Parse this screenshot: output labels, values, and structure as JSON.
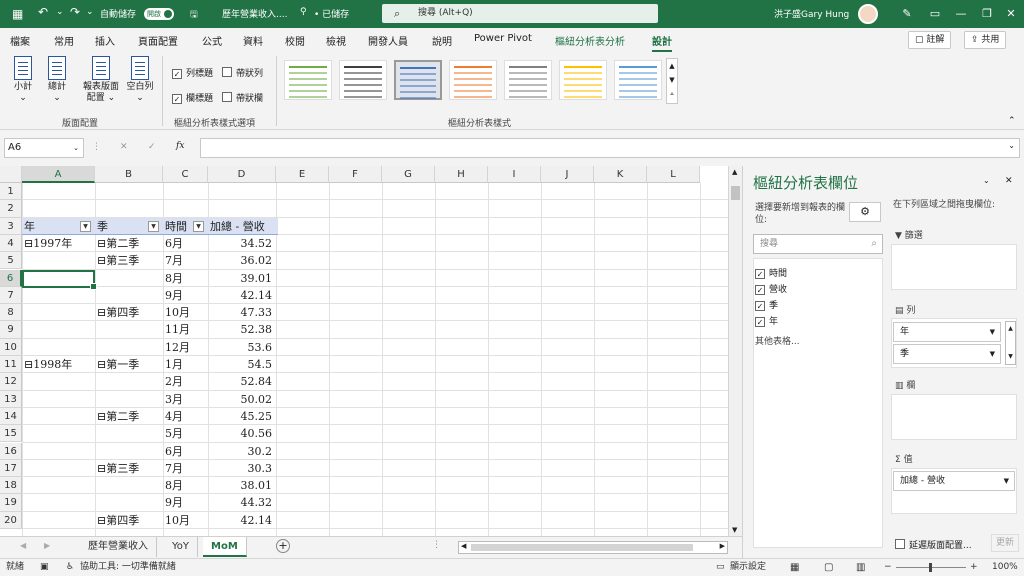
{
  "titlebar": {
    "autosave_label": "自動儲存",
    "autosave_state": "開啟",
    "filename": "歷年營業收入....",
    "save_status": "• 已儲存",
    "search_placeholder": "搜尋 (Alt+Q)",
    "user": "洪子盛Gary Hung"
  },
  "ribbon_tabs": [
    "檔案",
    "常用",
    "插入",
    "頁面配置",
    "公式",
    "資料",
    "校閱",
    "檢視",
    "開發人員",
    "說明",
    "Power Pivot",
    "樞紐分析表分析",
    "設計"
  ],
  "top_buttons": {
    "comment": "註解",
    "share": "共用"
  },
  "ribbon": {
    "layout_buttons": [
      {
        "label": "小計",
        "sub": "⌄"
      },
      {
        "label": "總計",
        "sub": "⌄"
      },
      {
        "label": "報表版面",
        "sub": "配置 ⌄"
      },
      {
        "label": "空白列",
        "sub": "⌄"
      }
    ],
    "layout_group": "版面配置",
    "options": [
      {
        "label": "列標題",
        "checked": true
      },
      {
        "label": "帶狀列",
        "checked": false
      },
      {
        "label": "欄標題",
        "checked": true
      },
      {
        "label": "帶狀欄",
        "checked": false
      }
    ],
    "options_group": "樞紐分析表樣式選項",
    "styles_group": "樞紐分析表樣式",
    "style_colors": [
      "#70ad47",
      "#404040",
      "#4472c4",
      "#ed7d31",
      "#808080",
      "#ffc000",
      "#5b9bd5"
    ]
  },
  "formula_bar": {
    "name_box": "A6",
    "fx": "fx",
    "cancel": "✕",
    "confirm": "✓"
  },
  "columns": [
    "A",
    "B",
    "C",
    "D",
    "E",
    "F",
    "G",
    "H",
    "I",
    "J",
    "K",
    "L"
  ],
  "rows": [
    "1",
    "2",
    "3",
    "4",
    "5",
    "6",
    "7",
    "8",
    "9",
    "10",
    "11",
    "12",
    "13",
    "14",
    "15",
    "16",
    "17",
    "18",
    "19",
    "20"
  ],
  "pivot": {
    "headers": [
      "年",
      "季",
      "時間",
      "加總 - 營收"
    ],
    "rows": [
      [
        "⊟1997年",
        "⊟第二季",
        "6月",
        "34.52"
      ],
      [
        "",
        "⊟第三季",
        "7月",
        "36.02"
      ],
      [
        "",
        "",
        "8月",
        "39.01"
      ],
      [
        "",
        "",
        "9月",
        "42.14"
      ],
      [
        "",
        "⊟第四季",
        "10月",
        "47.33"
      ],
      [
        "",
        "",
        "11月",
        "52.38"
      ],
      [
        "",
        "",
        "12月",
        "53.6"
      ],
      [
        "⊟1998年",
        "⊟第一季",
        "1月",
        "54.5"
      ],
      [
        "",
        "",
        "2月",
        "52.84"
      ],
      [
        "",
        "",
        "3月",
        "50.02"
      ],
      [
        "",
        "⊟第二季",
        "4月",
        "45.25"
      ],
      [
        "",
        "",
        "5月",
        "40.56"
      ],
      [
        "",
        "",
        "6月",
        "30.2"
      ],
      [
        "",
        "⊟第三季",
        "7月",
        "30.3"
      ],
      [
        "",
        "",
        "8月",
        "38.01"
      ],
      [
        "",
        "",
        "9月",
        "44.32"
      ],
      [
        "",
        "⊟第四季",
        "10月",
        "42.14"
      ]
    ]
  },
  "sheets": [
    "歷年營業收入",
    "YoY",
    "MoM"
  ],
  "active_sheet": "MoM",
  "pane": {
    "title": "樞紐分析表欄位",
    "choose_label": "選擇要新增到報表的欄位:",
    "drag_label": "在下列區域之間拖曳欄位:",
    "search_placeholder": "搜尋",
    "fields": [
      {
        "label": "時間",
        "checked": true
      },
      {
        "label": "營收",
        "checked": true
      },
      {
        "label": "季",
        "checked": true
      },
      {
        "label": "年",
        "checked": true
      }
    ],
    "more_tables": "其他表格...",
    "filters_label": "篩選",
    "rows_label": "列",
    "rows_fields": [
      "年",
      "季"
    ],
    "columns_label": "欄",
    "values_label": "值",
    "values_fields": [
      "加總 - 營收"
    ],
    "defer_label": "延遲版面配置...",
    "update_button": "更新"
  },
  "status": {
    "ready": "就緒",
    "accessibility": "協助工具: 一切準備就緒",
    "display_settings": "顯示設定",
    "zoom": "100%"
  }
}
